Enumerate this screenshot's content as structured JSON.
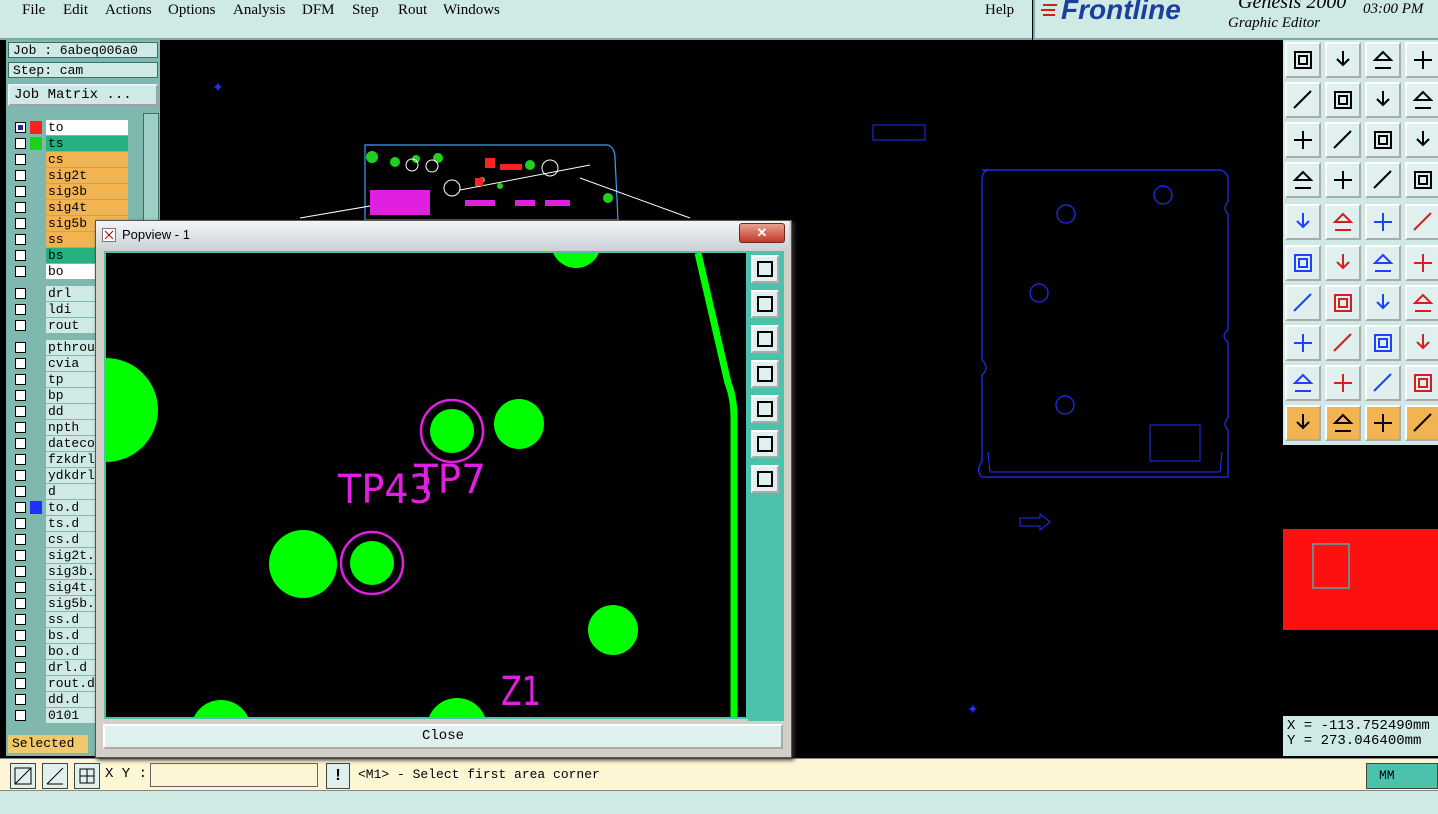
{
  "menu": [
    "File",
    "Edit",
    "Actions",
    "Options",
    "Analysis",
    "DFM",
    "Step",
    "Rout",
    "Windows"
  ],
  "menu_help": "Help",
  "brand": {
    "logo": "Frontline",
    "product": "Genesis 2000",
    "subtitle": "Graphic Editor",
    "time": "03:00 PM"
  },
  "job": {
    "job_label": "Job : 6abeq006a0",
    "step_label": "Step: cam",
    "matrix_button": "Job Matrix ..."
  },
  "layers": [
    {
      "name": "to",
      "color": "#ffffff",
      "mark": "#ff2020",
      "active": true
    },
    {
      "name": "ts",
      "color": "#25b07f",
      "mark": "#20d020"
    },
    {
      "name": "cs",
      "color": "#f2b450"
    },
    {
      "name": "sig2t",
      "color": "#f2b450"
    },
    {
      "name": "sig3b",
      "color": "#f2b450"
    },
    {
      "name": "sig4t",
      "color": "#f2b450"
    },
    {
      "name": "sig5b",
      "color": "#f2b450"
    },
    {
      "name": "ss",
      "color": "#f2b450"
    },
    {
      "name": "bs",
      "color": "#25b07f"
    },
    {
      "name": "bo",
      "color": "#ffffff"
    },
    {
      "name": "drl",
      "color": "#cfe9e4"
    },
    {
      "name": "ldi",
      "color": "#cfe9e4"
    },
    {
      "name": "rout",
      "color": "#cfe9e4"
    },
    {
      "name": "pthrou",
      "color": "#cfe9e4"
    },
    {
      "name": "cvia",
      "color": "#cfe9e4"
    },
    {
      "name": "tp",
      "color": "#cfe9e4"
    },
    {
      "name": "bp",
      "color": "#cfe9e4"
    },
    {
      "name": "dd",
      "color": "#cfe9e4"
    },
    {
      "name": "npth",
      "color": "#cfe9e4"
    },
    {
      "name": "dateco",
      "color": "#cfe9e4"
    },
    {
      "name": "fzkdrl",
      "color": "#cfe9e4"
    },
    {
      "name": "ydkdrl",
      "color": "#cfe9e4"
    },
    {
      "name": "d",
      "color": "#cfe9e4"
    },
    {
      "name": "to.d",
      "color": "#cfe9e4",
      "mark": "#2030ff"
    },
    {
      "name": "ts.d",
      "color": "#cfe9e4"
    },
    {
      "name": "cs.d",
      "color": "#cfe9e4"
    },
    {
      "name": "sig2t.",
      "color": "#cfe9e4"
    },
    {
      "name": "sig3b.",
      "color": "#cfe9e4"
    },
    {
      "name": "sig4t.",
      "color": "#cfe9e4"
    },
    {
      "name": "sig5b.",
      "color": "#cfe9e4"
    },
    {
      "name": "ss.d",
      "color": "#cfe9e4"
    },
    {
      "name": "bs.d",
      "color": "#cfe9e4"
    },
    {
      "name": "bo.d",
      "color": "#cfe9e4"
    },
    {
      "name": "drl.d",
      "color": "#cfe9e4"
    },
    {
      "name": "rout.d",
      "color": "#cfe9e4"
    },
    {
      "name": "dd.d",
      "color": "#cfe9e4"
    },
    {
      "name": "0101",
      "color": "#cfe9e4"
    }
  ],
  "selected_label": "Selected :",
  "popup": {
    "title": "Popview - 1",
    "close_button": "Close",
    "labels": [
      "TP43",
      "TP7",
      "Z1"
    ]
  },
  "coords": {
    "x": "X = -113.752490mm",
    "y": "Y = 273.046400mm"
  },
  "status": {
    "xy_label": "X Y :",
    "xy_value": "",
    "message": "<M1> - Select first area corner",
    "units": "MM"
  },
  "colors": {
    "panel": "#cfe9e4",
    "accent": "#4bc2ab",
    "pad": "#00ff00",
    "silk": "#e020e0",
    "outline": "#2030ff"
  }
}
